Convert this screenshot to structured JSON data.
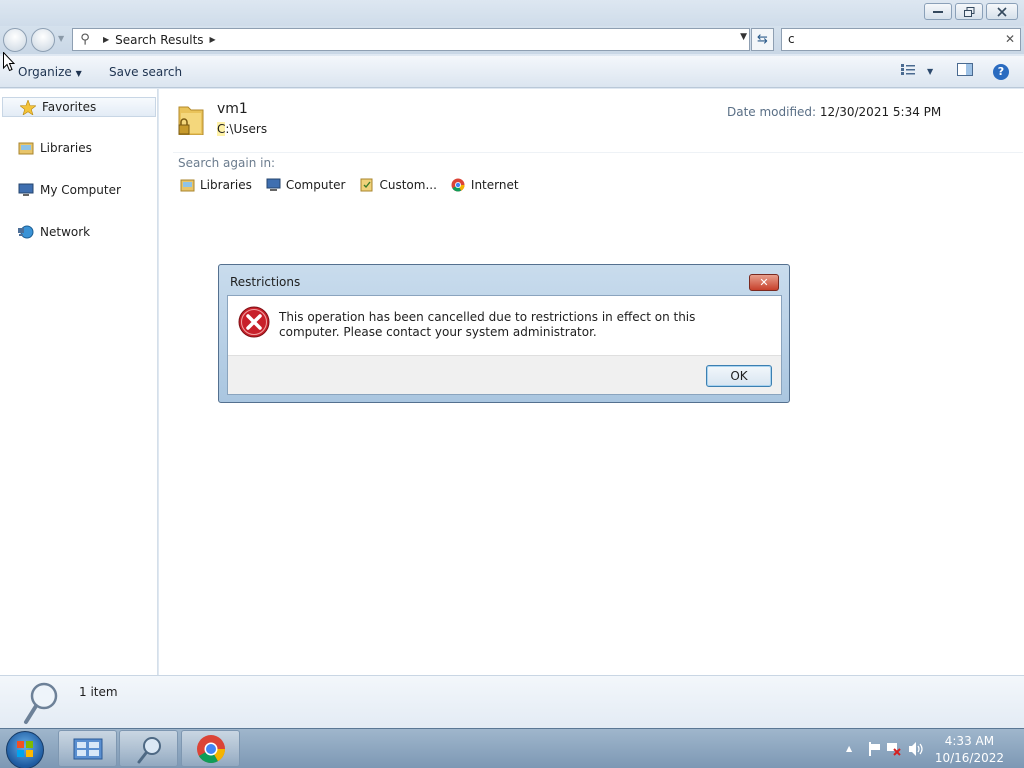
{
  "window": {
    "minimize_icon": "minimize-icon",
    "restore_icon": "restore-icon",
    "close_icon": "close-icon"
  },
  "navbar": {
    "address_crumb": "Search Results",
    "search_value": "c",
    "search_clear": "✕"
  },
  "toolbar": {
    "organize": "Organize",
    "save_search": "Save search"
  },
  "sidebar": {
    "items": [
      {
        "label": "Favorites",
        "icon": "star-icon"
      },
      {
        "label": "Libraries",
        "icon": "libraries-icon"
      },
      {
        "label": "My Computer",
        "icon": "computer-icon"
      },
      {
        "label": "Network",
        "icon": "network-icon"
      }
    ]
  },
  "result": {
    "name": "vm1",
    "path_highlight": "C",
    "path_rest": ":\\Users",
    "date_label": "Date modified:",
    "date_value": "12/30/2021 5:34 PM"
  },
  "search_again": {
    "label": "Search again in:",
    "items": [
      "Libraries",
      "Computer",
      "Custom...",
      "Internet"
    ]
  },
  "details": {
    "count": "1 item"
  },
  "dialog": {
    "title": "Restrictions",
    "message": "This operation has been cancelled due to restrictions in effect on this computer. Please contact your system administrator.",
    "ok": "OK"
  },
  "taskbar": {
    "time": "4:33 AM",
    "date": "10/16/2022"
  },
  "colors": {
    "accent": "#2a6bc0",
    "error_red": "#c8202a",
    "chrome_red": "#db4437",
    "chrome_green": "#0f9d58",
    "chrome_yellow": "#f4b400"
  }
}
